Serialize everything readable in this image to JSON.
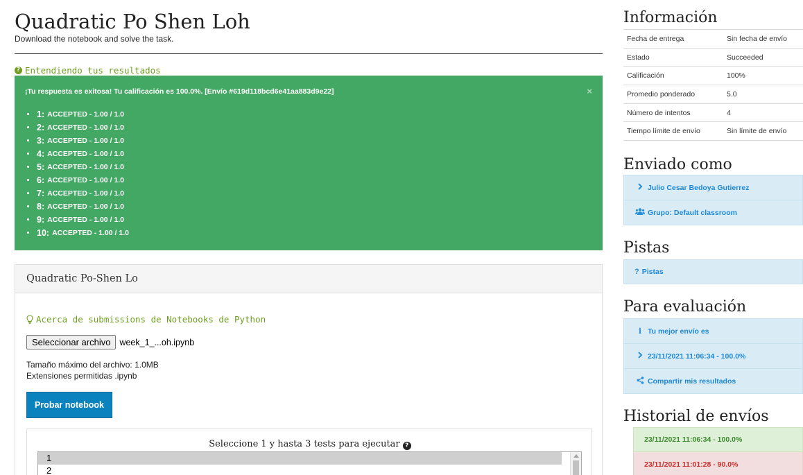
{
  "page": {
    "title": "Quadratic Po Shen Loh",
    "subtitle": "Download the notebook and solve the task.",
    "results_help": "Entendiendo tus resultados"
  },
  "result": {
    "heading": "¡Tu respuesta es exitosa! Tu calificación es 100.0%. [Envío #619d118bcd6e41aa883d9e22]",
    "close": "×",
    "tests": [
      {
        "num": "1:",
        "text": "ACCEPTED - 1.00 / 1.0"
      },
      {
        "num": "2:",
        "text": "ACCEPTED - 1.00 / 1.0"
      },
      {
        "num": "3:",
        "text": "ACCEPTED - 1.00 / 1.0"
      },
      {
        "num": "4:",
        "text": "ACCEPTED - 1.00 / 1.0"
      },
      {
        "num": "5:",
        "text": "ACCEPTED - 1.00 / 1.0"
      },
      {
        "num": "6:",
        "text": "ACCEPTED - 1.00 / 1.0"
      },
      {
        "num": "7:",
        "text": "ACCEPTED - 1.00 / 1.0"
      },
      {
        "num": "8:",
        "text": "ACCEPTED - 1.00 / 1.0"
      },
      {
        "num": "9:",
        "text": "ACCEPTED - 1.00 / 1.0"
      },
      {
        "num": "10:",
        "text": "ACCEPTED - 1.00 / 1.0"
      }
    ]
  },
  "notebook": {
    "card_title": "Quadratic Po-Shen Lo",
    "help": "Acerca de submissions de Notebooks de Python",
    "file_button": "Seleccionar archivo",
    "file_name": "week_1_...oh.ipynb",
    "max_size": "Tamaño máximo del archivo: 1.0MB",
    "extensions": "Extensiones permitidas .ipynb",
    "test_button": "Probar notebook",
    "tests_label": "Seleccione 1 y hasta 3 tests para ejecutar",
    "test_options": [
      "1",
      "2"
    ],
    "selected_option": "1"
  },
  "sidebar": {
    "info_heading": "Información",
    "info": [
      {
        "label": "Fecha de entrega",
        "value": "Sin fecha de envío"
      },
      {
        "label": "Estado",
        "value": "Succeeded"
      },
      {
        "label": "Calificación",
        "value": "100%"
      },
      {
        "label": "Promedio ponderado",
        "value": "5.0"
      },
      {
        "label": "Número de intentos",
        "value": "4"
      },
      {
        "label": "Tiempo límite de envío",
        "value": "Sin límite de envío"
      }
    ],
    "sent_as_heading": "Enviado como",
    "sent_as": [
      {
        "icon": "chevron-right-icon",
        "label": "Julio Cesar Bedoya Gutierrez"
      },
      {
        "icon": "users-icon",
        "label": "Grupo: Default classroom"
      }
    ],
    "hints_heading": "Pistas",
    "hints_item": "Pistas",
    "evaluation_heading": "Para evaluación",
    "evaluation": [
      {
        "icon": "info-icon",
        "label": "Tu mejor envío es"
      },
      {
        "icon": "chevron-right-icon",
        "label": "23/11/2021 11:06:34 - 100.0%"
      },
      {
        "icon": "share-icon",
        "label": "Compartir mis resultados"
      }
    ],
    "history_heading": "Historial de envíos",
    "history": [
      {
        "label": "23/11/2021 11:06:34 - 100.0%",
        "status": "success"
      },
      {
        "label": "23/11/2021 11:01:28 - 90.0%",
        "status": "error"
      }
    ]
  },
  "colors": {
    "success": "#44a865",
    "link_green": "#6f9e1f",
    "primary": "#0a82be",
    "info_bg": "#d9ecf6",
    "link_blue": "#1e88d6"
  }
}
